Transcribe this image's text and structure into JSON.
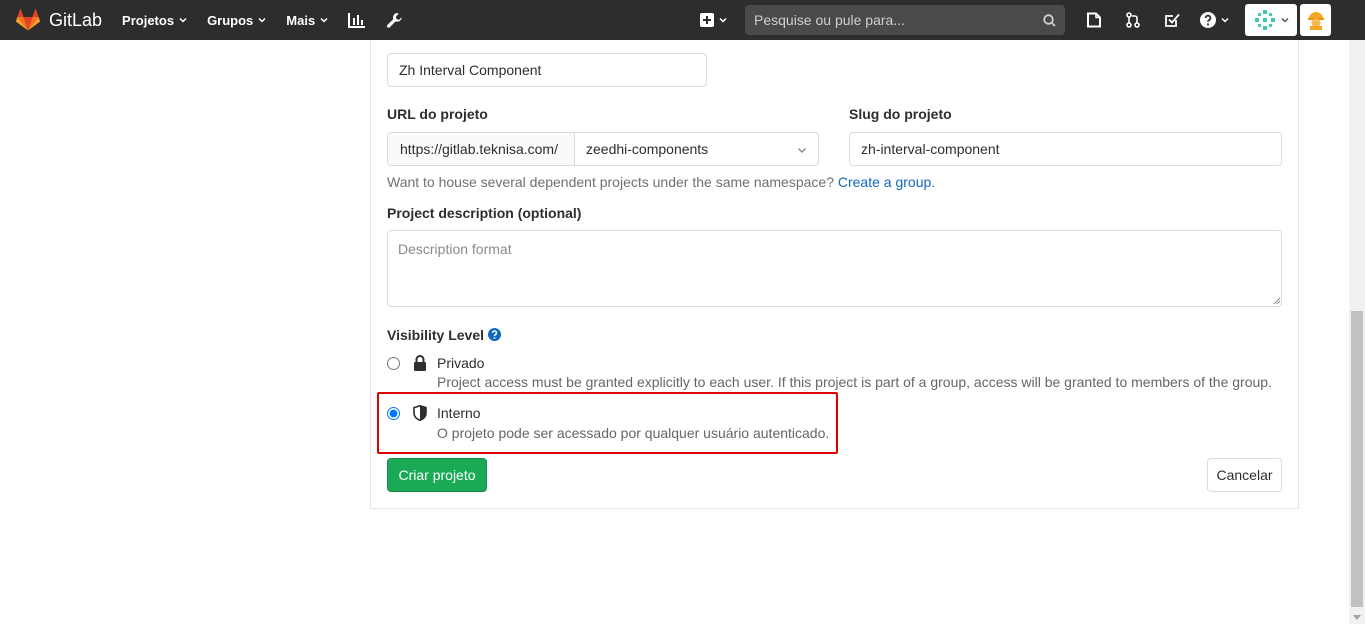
{
  "nav": {
    "brand": "GitLab",
    "items": [
      {
        "label": "Projetos"
      },
      {
        "label": "Grupos"
      },
      {
        "label": "Mais"
      }
    ],
    "search_placeholder": "Pesquise ou pule para...",
    "colors": {
      "bar": "#2d2d2d",
      "search_bg": "#4a4a4a"
    }
  },
  "form": {
    "project_name_value": "Zh Interval Component",
    "url_label": "URL do projeto",
    "url_prefix": "https://gitlab.teknisa.com/",
    "namespace_value": "zeedhi-components",
    "slug_label": "Slug do projeto",
    "slug_value": "zh-interval-component",
    "namespace_help": "Want to house several dependent projects under the same namespace?",
    "create_group_link": "Create a group.",
    "description_label": "Project description (optional)",
    "description_placeholder": "Description format",
    "visibility_label": "Visibility Level",
    "options": [
      {
        "title": "Privado",
        "desc": "Project access must be granted explicitly to each user. If this project is part of a group, access will be granted to members of the group.",
        "checked": false
      },
      {
        "title": "Interno",
        "desc": "O projeto pode ser acessado por qualquer usuário autenticado.",
        "checked": true
      }
    ],
    "create_button": "Criar projeto",
    "cancel_button": "Cancelar",
    "colors": {
      "primary": "#1aaa55",
      "link": "#1068bf",
      "highlight": "#e00000"
    }
  }
}
